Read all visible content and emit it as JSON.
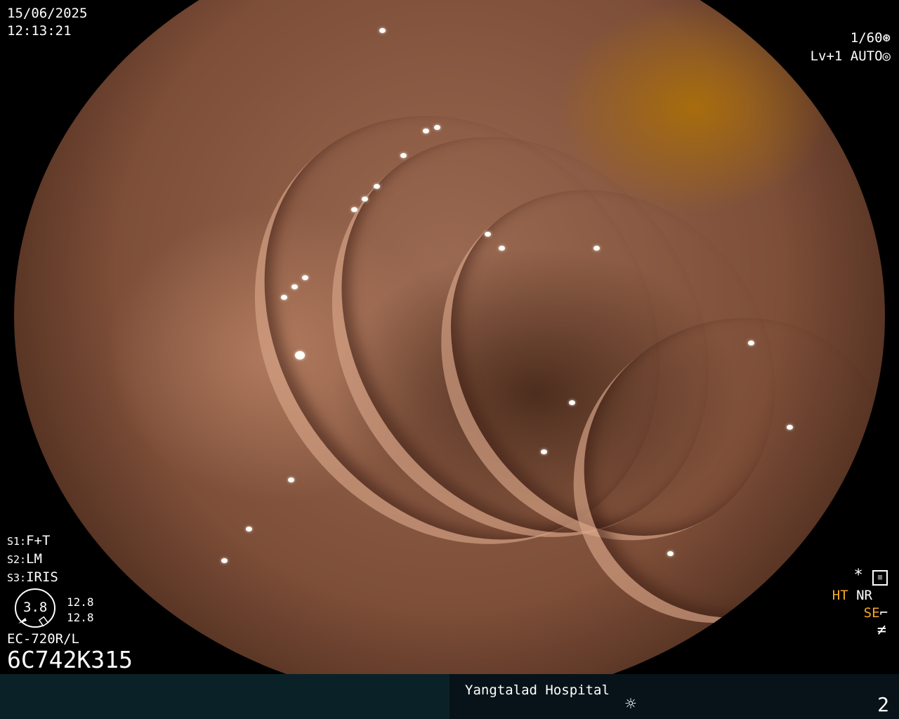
{
  "datetime": {
    "date": "15/06/2025",
    "time": "12:13:21"
  },
  "shutter": {
    "value": "1/60",
    "icon": "shutter-icon"
  },
  "exposure": {
    "level": "Lv+1",
    "mode": "AUTO",
    "icon": "auto-iris-icon"
  },
  "switches": [
    {
      "key": "S1:",
      "value": "F+T"
    },
    {
      "key": "S2:",
      "value": "LM"
    },
    {
      "key": "S3:",
      "value": "IRIS"
    }
  ],
  "scope": {
    "value": "3.8",
    "top": "12.8",
    "bottom": "12.8",
    "model": "EC-720R/L",
    "serial": "6C742K315"
  },
  "right_panel": {
    "ht": "HT",
    "nr": "NR",
    "se": "SE",
    "accent_color": "#f7a823"
  },
  "footer": {
    "hospital": "Yangtalad Hospital",
    "page_number": "2",
    "light_icon": "light-icon"
  }
}
